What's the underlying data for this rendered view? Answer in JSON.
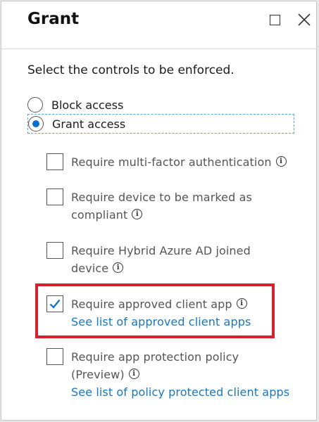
{
  "header": {
    "title": "Grant"
  },
  "instruction": "Select the controls to be enforced.",
  "radio_options": [
    {
      "label": "Block access",
      "selected": false
    },
    {
      "label": "Grant access",
      "selected": true
    }
  ],
  "controls": [
    {
      "label": "Require multi-factor authentication",
      "checked": false
    },
    {
      "label": "Require device to be marked as compliant",
      "checked": false
    },
    {
      "label": "Require Hybrid Azure AD joined device",
      "checked": false
    },
    {
      "label": "Require approved client app",
      "checked": true,
      "link": "See list of approved client apps",
      "highlighted": true
    },
    {
      "label": "Require app protection policy (Preview)",
      "checked": false,
      "link": "See list of policy protected client apps"
    }
  ],
  "icons": {
    "info": "info-icon",
    "maximize": "maximize-icon",
    "close": "close-icon",
    "checkmark": "checkmark-icon"
  },
  "colors": {
    "accent": "#0a6ed1",
    "link": "#1877c2",
    "highlight": "#d5202e"
  }
}
